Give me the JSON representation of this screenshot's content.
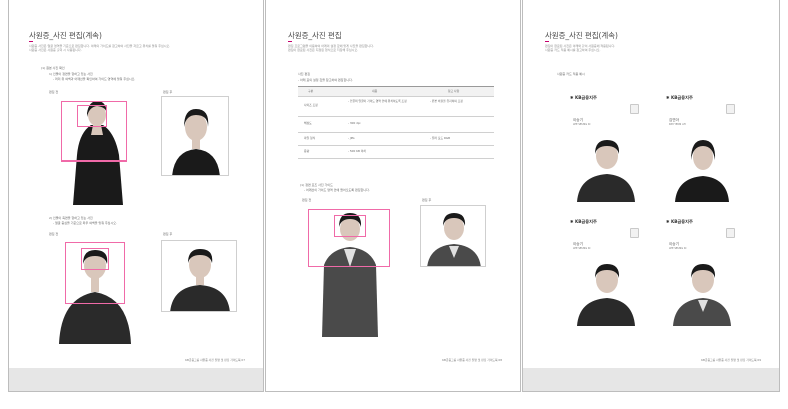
{
  "pages": [
    {
      "title": "사원증_사진 편집(계속)",
      "paragraph_lines": [
        "사원증 사진은 얼굴 영역을 기준으로 편집합니다. 아래의 가이드를 참고하여 사진을 자르고 위치를 맞춰 주십시오.",
        "사원증 사진은 사원증 출력 시 사용됩니다."
      ],
      "section_title": "(1) 원본 사진 확인",
      "subsection_a": "1) 인물이 정면을 향하고 있는 사진",
      "subsection_a_note": "- 머리 위 여백과 어깨선을 확인하여 가이드 영역에 맞춰 주십시오.",
      "subsection_b": "2) 인물이 측면을 향하고 있는 사진",
      "subsection_b_note": "- 얼굴 중심을 기준으로 좌우 여백을 맞춰 주십시오.",
      "before_label": "편집 전",
      "after_label": "편집 후",
      "footer": "KB금융그룹 사원증 사진 촬영 및 편집 가이드북    07"
    },
    {
      "title": "사원증_사진 편집",
      "paragraph_lines": [
        "편집 프로그램을 이용하여 아래의 설정 값에 맞게 사진을 편집합니다.",
        "편집이 완료된 사진은 지정된 형식으로 저장해 주십시오."
      ],
      "settings_title": "사진 편집",
      "settings_note": "- 아래 표의 설정 값을 참고하여 편집합니다.",
      "table_headers": [
        "구분",
        "내용",
        "참고 사항"
      ],
      "table_rows": [
        [
          "사이즈 조정",
          "- 인물의 얼굴이 가이드 영역 안에 위치하도록 조정",
          "- 원본 비율을 유지하며 조정"
        ],
        [
          "해상도",
          "- 300 dpi",
          ""
        ],
        [
          "파일 형식",
          "- JPG",
          "- 컬러 모드 RGB"
        ],
        [
          "용량",
          "- 500 KB 이하",
          ""
        ]
      ],
      "example_title": "(1) 정면 포즈 사진 가이드",
      "example_note": "- 어깨선이 가이드 영역 안에 들어오도록 편집합니다.",
      "before_label": "편집 전",
      "after_label": "편집 후",
      "footer": "KB금융그룹 사원증 사진 촬영 및 편집 가이드북    08"
    },
    {
      "title": "사원증_사진 편집(계속)",
      "paragraph_lines": [
        "편집이 완료된 사진은 아래와 같이 사원증에 적용됩니다.",
        "사원증 카드 적용 예시를 참고하여 주십시오."
      ],
      "example_title": "사원증 카드 적용 예시",
      "footer": "KB금융그룹 사원증 사진 촬영 및 편집 가이드북    09",
      "cards": [
        {
          "logo": "KB금융지주",
          "name": "이승기",
          "roman": "LEE SEUNG KI"
        },
        {
          "logo": "KB금융지주",
          "name": "김연아",
          "roman": "KIM YEON AH"
        },
        {
          "logo": "KB금융지주",
          "name": "이승기",
          "roman": "LEE SEUNG KI"
        },
        {
          "logo": "KB금융지주",
          "name": "이승기",
          "roman": "LEE SEUNG KI"
        }
      ]
    }
  ],
  "colors": {
    "accent": "#c5006c",
    "guide": "#f06aa8",
    "page_bg": "#ffffff",
    "gap_bg": "#e6e6e6"
  },
  "icons": {
    "logo": "kb-star-icon",
    "card_chip": "chip-icon"
  }
}
